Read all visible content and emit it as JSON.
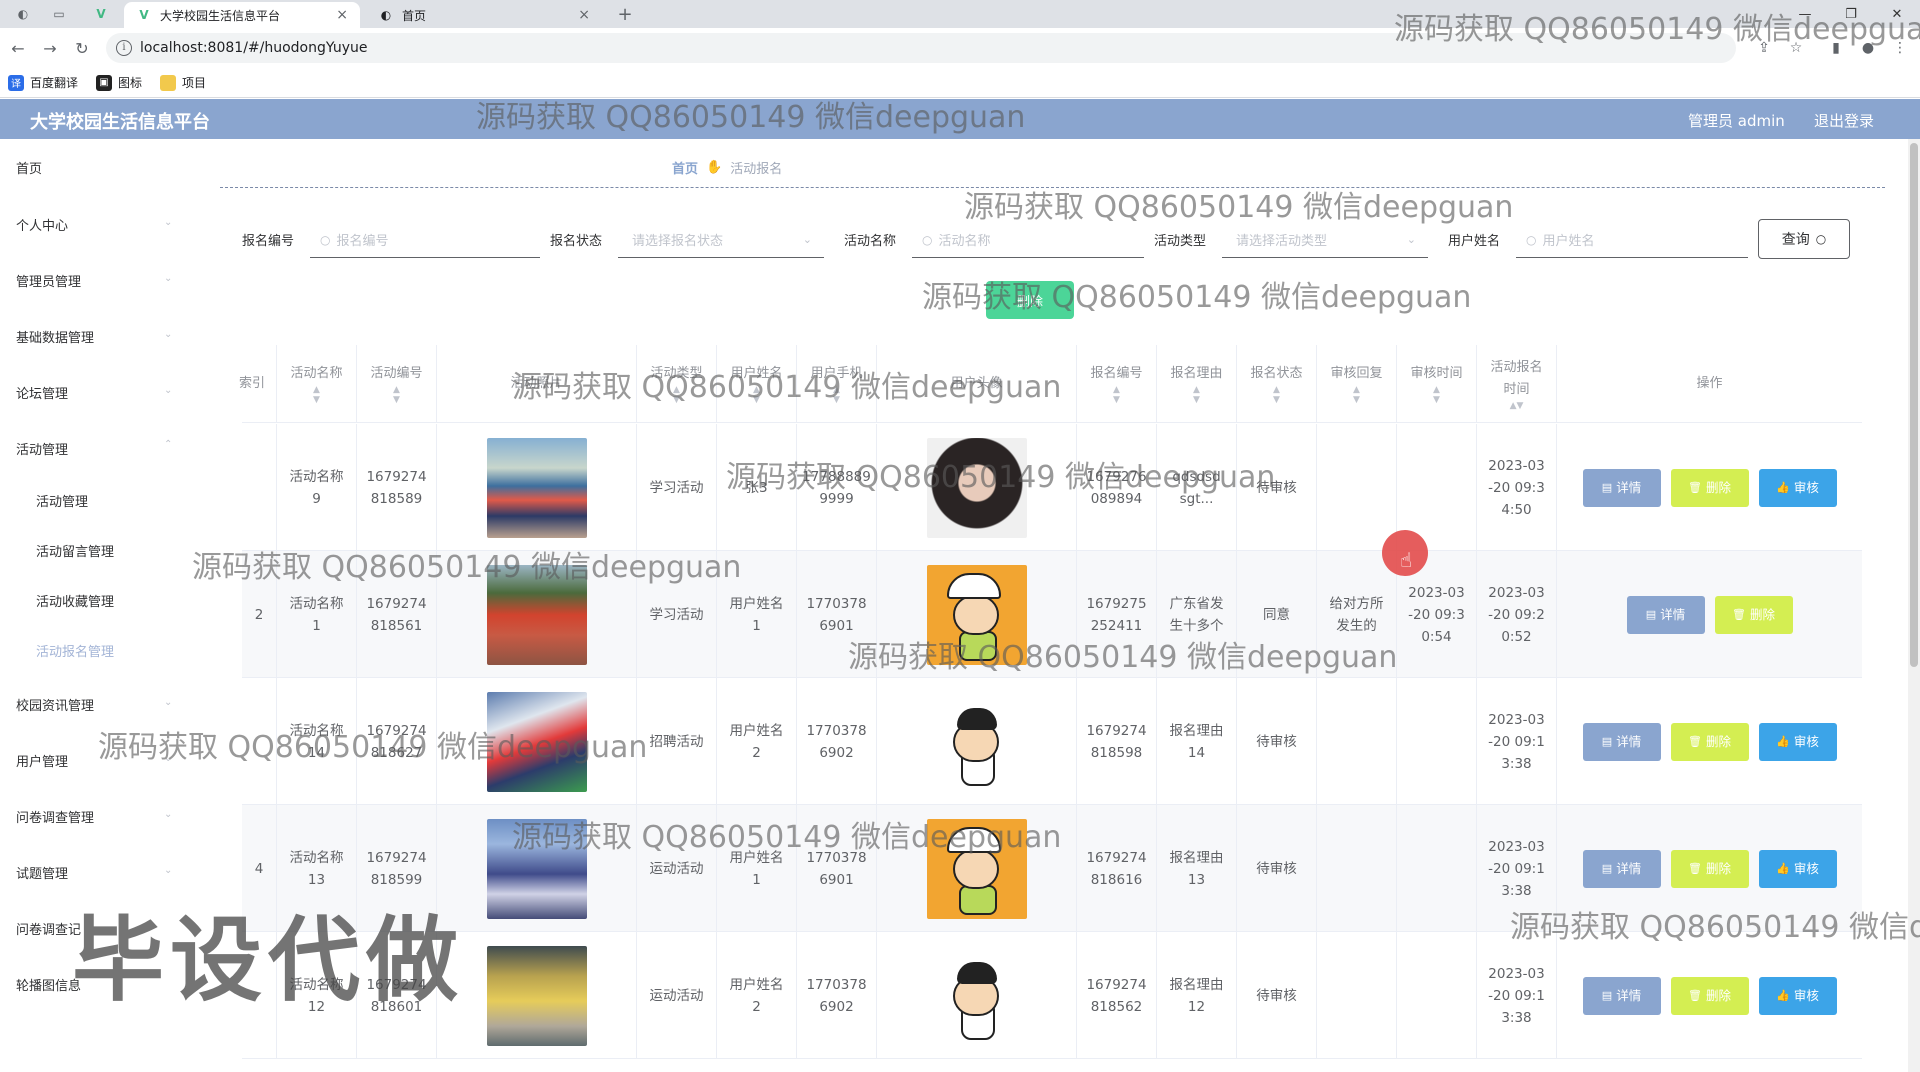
{
  "browser": {
    "tabs": [
      {
        "title": "大学校园生活信息平台",
        "active": true
      },
      {
        "title": "首页",
        "active": false
      }
    ],
    "url": "localhost:8081/#/huodongYuyue",
    "bookmarks": [
      "百度翻译",
      "图标",
      "项目"
    ]
  },
  "header": {
    "title": "大学校园生活信息平台",
    "admin": "管理员 admin",
    "logout": "退出登录",
    "color": "#8aa5cf"
  },
  "sidebar": {
    "items": [
      {
        "label": "首页"
      },
      {
        "label": "个人中心"
      },
      {
        "label": "管理员管理"
      },
      {
        "label": "基础数据管理"
      },
      {
        "label": "论坛管理"
      },
      {
        "label": "活动管理"
      },
      {
        "label": "活动管理"
      },
      {
        "label": "活动留言管理"
      },
      {
        "label": "活动收藏管理"
      },
      {
        "label": "活动报名管理"
      },
      {
        "label": "校园资讯管理"
      },
      {
        "label": "用户管理"
      },
      {
        "label": "问卷调查管理"
      },
      {
        "label": "试题管理"
      },
      {
        "label": "问卷调查记"
      },
      {
        "label": "轮播图信息"
      }
    ]
  },
  "breadcrumb": {
    "home": "首页",
    "current": "活动报名"
  },
  "filters": {
    "baoming_label": "报名编号",
    "baoming_placeholder": "报名编号",
    "status_label": "报名状态",
    "status_placeholder": "请选择报名状态",
    "name_label": "活动名称",
    "name_placeholder": "活动名称",
    "type_label": "活动类型",
    "type_placeholder": "请选择活动类型",
    "user_label": "用户姓名",
    "user_placeholder": "用户姓名",
    "query": "查询",
    "bulk_delete": "删除"
  },
  "table": {
    "headers": [
      "索引",
      "活动名称",
      "活动编号",
      "活动照片",
      "活动类型",
      "用户姓名",
      "用户手机",
      "用户头像",
      "报名编号",
      "报名理由",
      "报名状态",
      "审核回复",
      "审核时间",
      "活动报名时间",
      "操作"
    ],
    "rows": [
      {
        "index": "",
        "name": "活动名称\n9",
        "code": "1679274\n818589",
        "type": "学习活动",
        "user": "张3",
        "phone": "17788889\n9999",
        "bm": "1679276\n089894",
        "reason": "qdsdsd\nsgt...",
        "status": "待审核",
        "reply": "",
        "audit_time": "",
        "time": "2023-03\n-20 09:3\n4:50",
        "actions": [
          "详情",
          "删除",
          "审核"
        ]
      },
      {
        "index": "2",
        "name": "活动名称\n1",
        "code": "1679274\n818561",
        "type": "学习活动",
        "user": "用户姓名\n1",
        "phone": "1770378\n6901",
        "bm": "1679275\n252411",
        "reason": "广东省发\n生十多个",
        "status": "同意",
        "reply": "给对方所\n发生的",
        "audit_time": "2023-03\n-20 09:3\n0:54",
        "time": "2023-03\n-20 09:2\n0:52",
        "actions": [
          "详情",
          "删除"
        ]
      },
      {
        "index": "",
        "name": "活动名称\n14",
        "code": "1679274\n818627",
        "type": "招聘活动",
        "user": "用户姓名\n2",
        "phone": "1770378\n6902",
        "bm": "1679274\n818598",
        "reason": "报名理由\n14",
        "status": "待审核",
        "reply": "",
        "audit_time": "",
        "time": "2023-03\n-20 09:1\n3:38",
        "actions": [
          "详情",
          "删除",
          "审核"
        ]
      },
      {
        "index": "4",
        "name": "活动名称\n13",
        "code": "1679274\n818599",
        "type": "运动活动",
        "user": "用户姓名\n1",
        "phone": "1770378\n6901",
        "bm": "1679274\n818616",
        "reason": "报名理由\n13",
        "status": "待审核",
        "reply": "",
        "audit_time": "",
        "time": "2023-03\n-20 09:1\n3:38",
        "actions": [
          "详情",
          "删除",
          "审核"
        ]
      },
      {
        "index": "",
        "name": "活动名称\n12",
        "code": "1679274\n818601",
        "type": "运动活动",
        "user": "用户姓名\n2",
        "phone": "1770378\n6902",
        "bm": "1679274\n818562",
        "reason": "报名理由\n12",
        "status": "待审核",
        "reply": "",
        "audit_time": "",
        "time": "2023-03\n-20 09:1\n3:38",
        "actions": [
          "详情",
          "删除",
          "审核"
        ]
      }
    ]
  },
  "watermark": {
    "text": "源码获取 QQ86050149 微信deepguan",
    "big": "毕设代做"
  },
  "icons": [
    "info-icon",
    "search-icon",
    "chevron-down-icon",
    "document-icon",
    "trash-icon",
    "thumb-icon",
    "hand-icon"
  ]
}
